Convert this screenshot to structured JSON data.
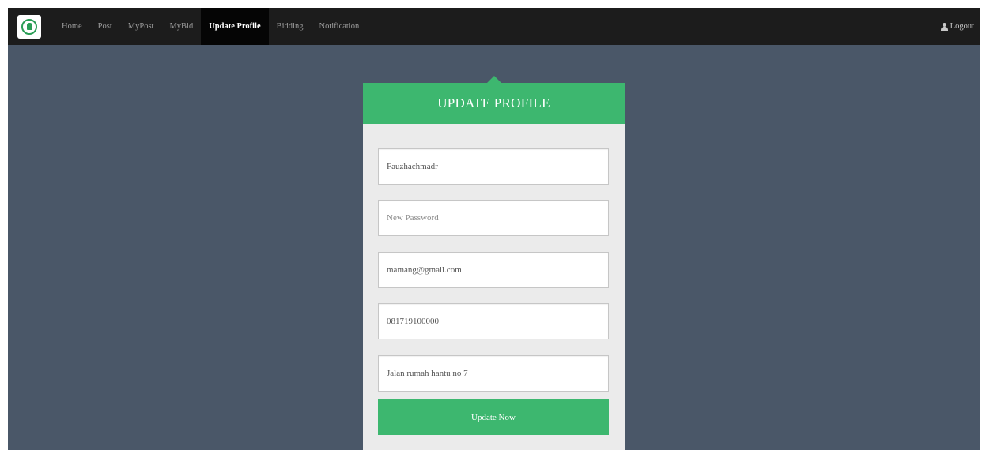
{
  "nav": {
    "items": [
      {
        "label": "Home"
      },
      {
        "label": "Post"
      },
      {
        "label": "MyPost"
      },
      {
        "label": "MyBid"
      },
      {
        "label": "Update Profile",
        "active": true
      },
      {
        "label": "Bidding"
      },
      {
        "label": "Notification"
      }
    ],
    "logout_label": "Logout"
  },
  "form": {
    "title": "UPDATE PROFILE",
    "username_value": "Fauzhachmadr",
    "password_placeholder": "New Password",
    "email_value": "mamang@gmail.com",
    "phone_value": "081719100000",
    "address_value": "Jalan rumah hantu no 7",
    "submit_label": "Update Now"
  },
  "colors": {
    "navbar": "#1c1c1c",
    "page_background": "#4a5768",
    "accent": "#3db76f",
    "card_background": "#ebebeb"
  }
}
